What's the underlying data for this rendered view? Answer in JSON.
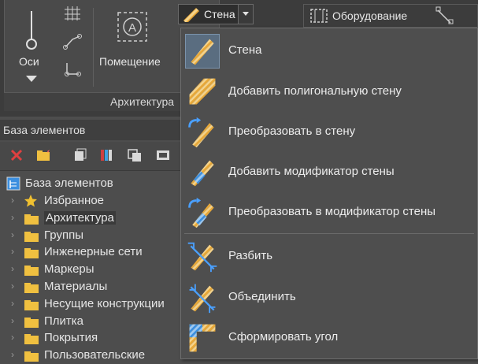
{
  "ribbon": {
    "axes_label": "Оси",
    "room_label": "Помещение",
    "panel_title": "Архитектура",
    "wall_button_label": "Стена",
    "equipment_label": "Оборудование"
  },
  "element_base": {
    "title": "База элементов",
    "root_label": "База элементов",
    "items": [
      {
        "label": "Избранное",
        "icon": "star-icon"
      },
      {
        "label": "Архитектура",
        "icon": "folder-icon"
      },
      {
        "label": "Группы",
        "icon": "folder-icon"
      },
      {
        "label": "Инженерные сети",
        "icon": "folder-icon"
      },
      {
        "label": "Маркеры",
        "icon": "folder-icon"
      },
      {
        "label": "Материалы",
        "icon": "folder-icon"
      },
      {
        "label": "Несущие конструкции",
        "icon": "folder-icon"
      },
      {
        "label": "Плитка",
        "icon": "folder-icon"
      },
      {
        "label": "Покрытия",
        "icon": "folder-icon"
      },
      {
        "label": "Пользовательские",
        "icon": "folder-icon"
      }
    ]
  },
  "wall_menu": {
    "items": [
      {
        "label": "Стена",
        "icon": "wall-icon"
      },
      {
        "label": "Добавить полигональную стену",
        "icon": "polygon-wall-icon"
      },
      {
        "label": "Преобразовать в стену",
        "icon": "convert-to-wall-icon"
      },
      {
        "label": "Добавить модификатор стены",
        "icon": "wall-modifier-icon"
      },
      {
        "label": "Преобразовать в модификатор стены",
        "icon": "convert-to-modifier-icon"
      },
      {
        "label": "Разбить",
        "icon": "split-wall-icon"
      },
      {
        "label": "Объединить",
        "icon": "join-wall-icon"
      },
      {
        "label": "Сформировать угол",
        "icon": "corner-icon"
      }
    ]
  },
  "colors": {
    "wall_orange": "#e8a838",
    "modifier_blue": "#3b8fe0",
    "selection": "#5a6d80"
  }
}
